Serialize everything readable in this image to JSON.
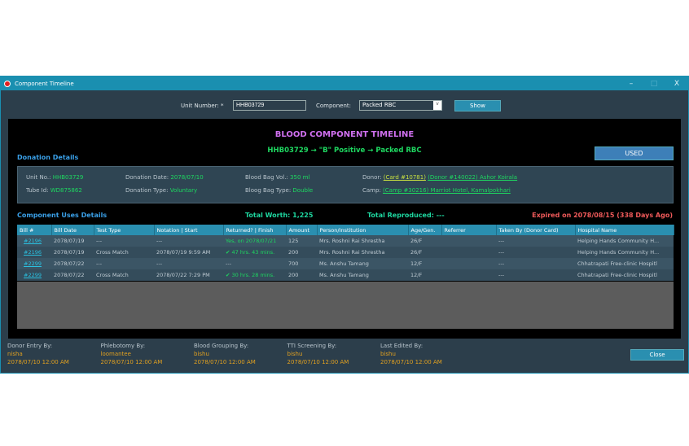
{
  "window": {
    "title": "Component Timeline",
    "minimize": "–",
    "maximize": "□",
    "close": "X"
  },
  "search": {
    "unit_label": "Unit Number: *",
    "unit_value": "HHB03729",
    "component_label": "Component:",
    "component_value": "Packed RBC",
    "show_label": "Show"
  },
  "header": {
    "title": "BLOOD COMPONENT TIMELINE",
    "subtitle": "HHB03729 → \"B\" Positive → Packed RBC",
    "status": "USED"
  },
  "donation": {
    "section": "Donation Details",
    "unit_no_label": "Unit No.:",
    "unit_no": "HHB03729",
    "tube_label": "Tube Id:",
    "tube": "WD875862",
    "date_label": "Donation Date:",
    "date": "2078/07/10",
    "type_label": "Donation Type:",
    "type": "Voluntary",
    "vol_label": "Blood Bag Vol.:",
    "vol": "350 ml",
    "bagtype_label": "Bloog Bag Type:",
    "bagtype": "Double",
    "donor_label": "Donor:",
    "donor_card": "(Card #10781)",
    "donor": "(Donor #140022) Ashor Koirala",
    "camp_label": "Camp:",
    "camp": "(Camp #30216) Marriot Hotel, Kamalpokhari"
  },
  "uses": {
    "section": "Component Uses Details",
    "total_worth": "Total Worth: 1,225",
    "total_reproduced": "Total Reproduced: ---",
    "expired": "Expired on 2078/08/15 (338 Days Ago)",
    "columns": [
      "Bill #",
      "Bill Date",
      "Test Type",
      "Notation | Start",
      "Returned? | Finish",
      "Amount",
      "Person/Institution",
      "Age/Gen.",
      "Referrer",
      "Taken By (Donor Card)",
      "Hospital Name"
    ],
    "rows": [
      [
        "#2196",
        "2078/07/19",
        "---",
        "---",
        "Yes, on 2078/07/21",
        "125",
        "Mrs. Roshni Rai Shrestha",
        "26/F",
        "",
        "---",
        "Helping Hands Community H..."
      ],
      [
        "#2196",
        "2078/07/19",
        "Cross Match",
        "2078/07/19 9:59 AM",
        "✔ 47 hrs. 43 mins.",
        "200",
        "Mrs. Roshni Rai Shrestha",
        "26/F",
        "",
        "---",
        "Helping Hands Community H..."
      ],
      [
        "#2299",
        "2078/07/22",
        "---",
        "---",
        "---",
        "700",
        "Ms. Anshu Tamang",
        "12/F",
        "",
        "---",
        "Chhatrapati Free-clinic Hospitl"
      ],
      [
        "#2299",
        "2078/07/22",
        "Cross Match",
        "2078/07/22 7:29 PM",
        "✔ 30 hrs. 28 mins.",
        "200",
        "Ms. Anshu Tamang",
        "12/F",
        "",
        "---",
        "Chhatrapati Free-clinic Hospitl"
      ]
    ]
  },
  "footer": [
    {
      "label": "Donor Entry By:",
      "user": "nisha",
      "date": "2078/07/10 12:00 AM"
    },
    {
      "label": "Phlebotomy By:",
      "user": "loomantee",
      "date": "2078/07/10 12:00 AM"
    },
    {
      "label": "Blood Grouping By:",
      "user": "bishu",
      "date": "2078/07/10 12:00 AM"
    },
    {
      "label": "TTI Screening By:",
      "user": "bishu",
      "date": "2078/07/10 12:00 AM"
    },
    {
      "label": "Last Edited By:",
      "user": "bishu",
      "date": "2078/07/10 12:00 AM"
    }
  ],
  "close_label": "Close"
}
